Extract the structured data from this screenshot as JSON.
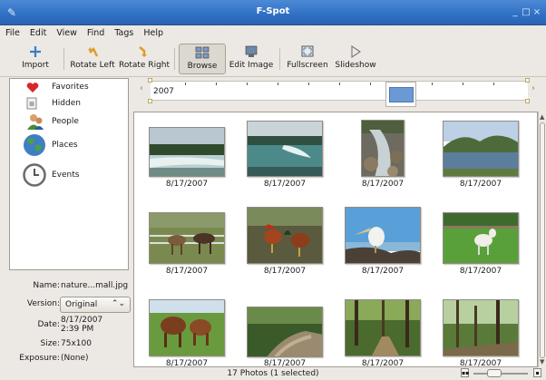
{
  "window": {
    "title": "F-Spot",
    "controls": [
      "_",
      "□",
      "×"
    ]
  },
  "menubar": {
    "items": [
      "File",
      "Edit",
      "View",
      "Find",
      "Tags",
      "Help"
    ]
  },
  "toolbar": {
    "buttons": [
      {
        "label": "Import",
        "icon": "import-icon"
      },
      {
        "label": "Rotate Left",
        "icon": "rotate-left-icon"
      },
      {
        "label": "Rotate Right",
        "icon": "rotate-right-icon"
      },
      {
        "label": "Browse",
        "icon": "browse-icon",
        "active": true
      },
      {
        "label": "Edit Image",
        "icon": "edit-image-icon"
      },
      {
        "label": "Fullscreen",
        "icon": "fullscreen-icon"
      },
      {
        "label": "Slideshow",
        "icon": "slideshow-icon"
      }
    ]
  },
  "sidebar": {
    "categories": [
      {
        "label": "Favorites",
        "icon": "heart-icon",
        "color": "#d8262c"
      },
      {
        "label": "Hidden",
        "icon": "hidden-icon",
        "color": "#8a8a8a"
      },
      {
        "label": "People",
        "icon": "people-icon",
        "color": "#4a8a3a"
      },
      {
        "label": "Places",
        "icon": "globe-icon",
        "color": "#3f7fc1"
      },
      {
        "label": "Events",
        "icon": "clock-icon",
        "color": "#6a6a6a"
      }
    ]
  },
  "info": {
    "name_label": "Name:",
    "name_value": "nature...mall.jpg",
    "version_label": "Version:",
    "version_value": "Original",
    "date_label": "Date:",
    "date_value": "8/17/2007",
    "time_value": "2:39 PM",
    "size_label": "Size:",
    "size_value": "75x100",
    "exposure_label": "Exposure:",
    "exposure_value": "(None)"
  },
  "timeline": {
    "year": "2007"
  },
  "photos": [
    {
      "date": "8/17/2007",
      "scene": "waterfall-wide"
    },
    {
      "date": "8/17/2007",
      "scene": "waterfall-teal"
    },
    {
      "date": "8/17/2007",
      "scene": "rocky-stream"
    },
    {
      "date": "8/17/2007",
      "scene": "lake-trees"
    },
    {
      "date": "8/17/2007",
      "scene": "horses"
    },
    {
      "date": "8/17/2007",
      "scene": "roosters"
    },
    {
      "date": "8/17/2007",
      "scene": "pelican"
    },
    {
      "date": "8/17/2007",
      "scene": "goat"
    },
    {
      "date": "8/17/2007",
      "scene": "cows"
    },
    {
      "date": "8/17/2007",
      "scene": "path-trees"
    },
    {
      "date": "8/17/2007",
      "scene": "forest-path"
    },
    {
      "date": "8/17/2007",
      "scene": "forest-sun"
    }
  ],
  "status": {
    "text": "17 Photos (1 selected)"
  },
  "zoom": {
    "level": 0.35
  }
}
